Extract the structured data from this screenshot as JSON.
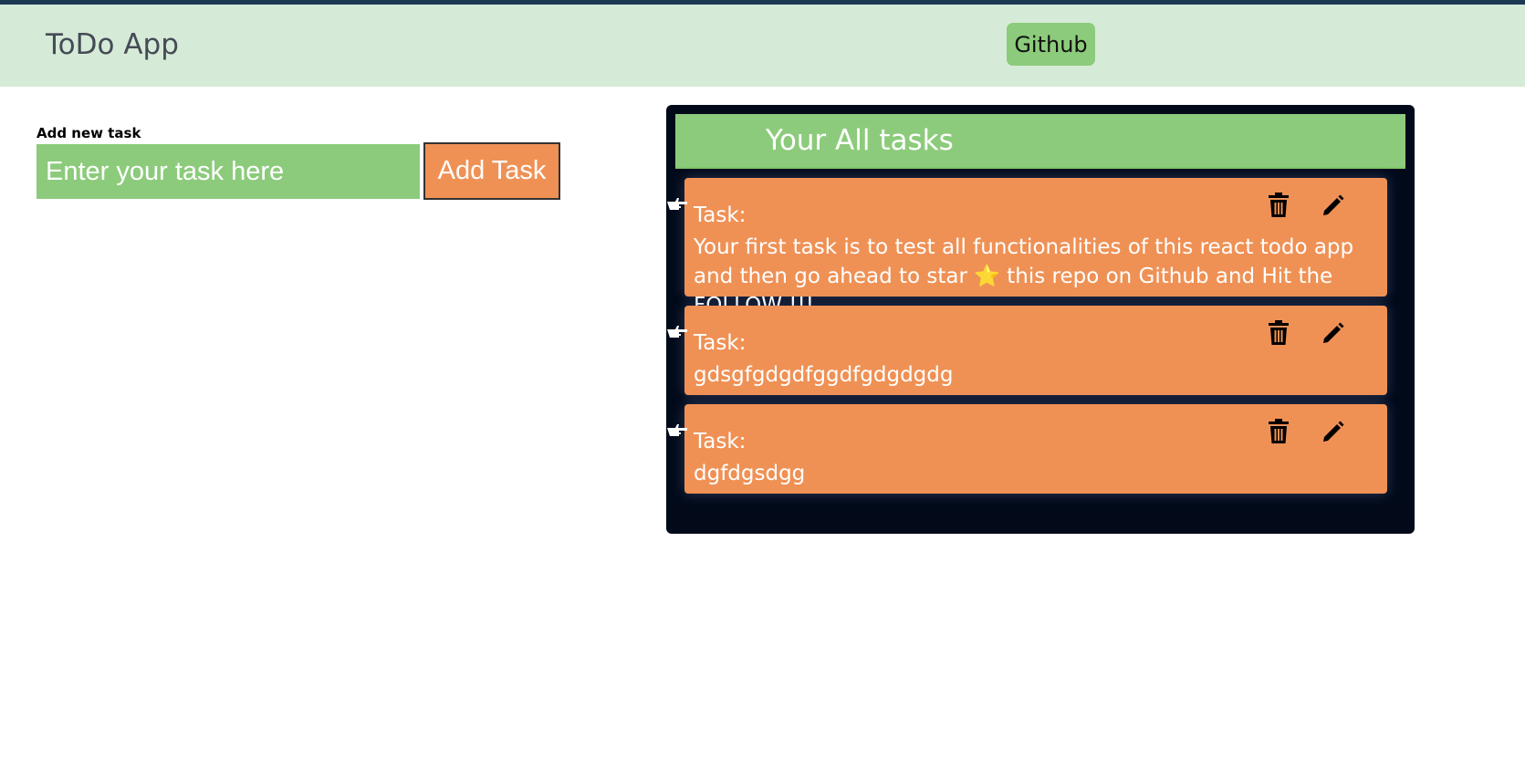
{
  "header": {
    "brand": "ToDo App",
    "github_label": "Github"
  },
  "form": {
    "label": "Add new task",
    "placeholder": "Enter your task here",
    "add_button": "Add Task"
  },
  "tasks_panel": {
    "title": "Your All tasks",
    "tasks": [
      {
        "label": "Task:",
        "text": "Your first task is to test all functionalities of this react todo app and then go ahead to star ⭐ this repo on Github and Hit the FOLLOW !!!"
      },
      {
        "label": "Task:",
        "text": "gdsgfgdgdfggdfgdgdgdg"
      },
      {
        "label": "Task:",
        "text": "dgfdgsdgg"
      }
    ]
  },
  "icons": {
    "pointer": "hand-pointing-right-icon",
    "delete": "trash-icon",
    "edit": "pencil-icon"
  },
  "colors": {
    "navbar_bg": "#d6ebd7",
    "green": "#8ccb7b",
    "orange": "#ef9155",
    "panel_bg": "#020a1a"
  }
}
